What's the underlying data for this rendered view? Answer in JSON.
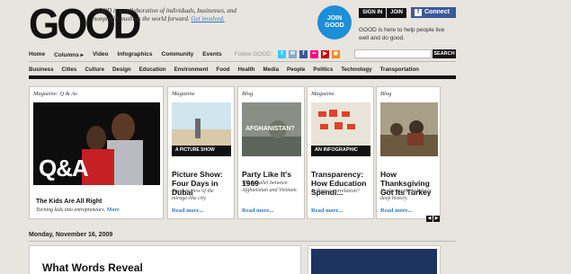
{
  "header": {
    "logo": "GOOD",
    "tagline": "GOOD is a collaboration of individuals, businesses, and nonprofits pushing the world forward.",
    "tagline_link": "Get involved.",
    "join_circle": [
      "JOIN",
      "GOOD"
    ],
    "signin_label": "SIGN IN",
    "join_label": "JOIN",
    "connect_label": "Connect",
    "help_text": "GOOD is here to help people live well and do good."
  },
  "mainnav": {
    "items": [
      "Home",
      "Columns ▸",
      "Video",
      "Infographics",
      "Community",
      "Events"
    ],
    "follow_label": "Follow GOOD:",
    "social_icons": [
      {
        "name": "twitter-icon",
        "glyph": "t",
        "color": "#33ccff"
      },
      {
        "name": "share-icon",
        "glyph": "✉",
        "color": "#88aacc"
      },
      {
        "name": "facebook-icon",
        "glyph": "f",
        "color": "#3b5998"
      },
      {
        "name": "flickr-icon",
        "glyph": "••",
        "color": "#ff0084"
      },
      {
        "name": "youtube-icon",
        "glyph": "▶",
        "color": "#cc0000"
      },
      {
        "name": "rss-icon",
        "glyph": "◉",
        "color": "#f28c1a"
      }
    ],
    "search_placeholder": "",
    "search_button": "SEARCH"
  },
  "categories": [
    "Business",
    "Cities",
    "Culture",
    "Design",
    "Education",
    "Environment",
    "Food",
    "Health",
    "Media",
    "People",
    "Politics",
    "Technology",
    "Transportation"
  ],
  "featured": {
    "type": "Magazine: Q & As",
    "overlay": "Q&A",
    "title": "The Kids Are All Right",
    "desc": "Turning kids into entrepreneurs.",
    "more": "More"
  },
  "cards": [
    {
      "type": "Magazine",
      "title": "Picture Show: Four Days in Dubai",
      "desc": "Another view of the mirage-like city.",
      "more": "Read more...",
      "img_caption": "A PICTURE SHOW"
    },
    {
      "type": "Blog",
      "title": "Party Like It's 1969",
      "desc": "The parallel between Afghanistan and Vietnam.",
      "more": "Read more...",
      "img_caption": "AFGHANISTAN?"
    },
    {
      "type": "Magazine",
      "title": "Transparency: How Education Spendi...",
      "desc": "Is there a correlation?",
      "more": "Read more...",
      "img_caption": "AN INFOGRAPHIC"
    },
    {
      "type": "Blog",
      "title": "How Thanksgiving Got Its Turkey",
      "desc": "Exploring the holiday's deep history.",
      "more": "Read more...",
      "img_caption": ""
    }
  ],
  "date_label": "Monday, November 16, 2009",
  "lower_headline": "What Words Reveal"
}
